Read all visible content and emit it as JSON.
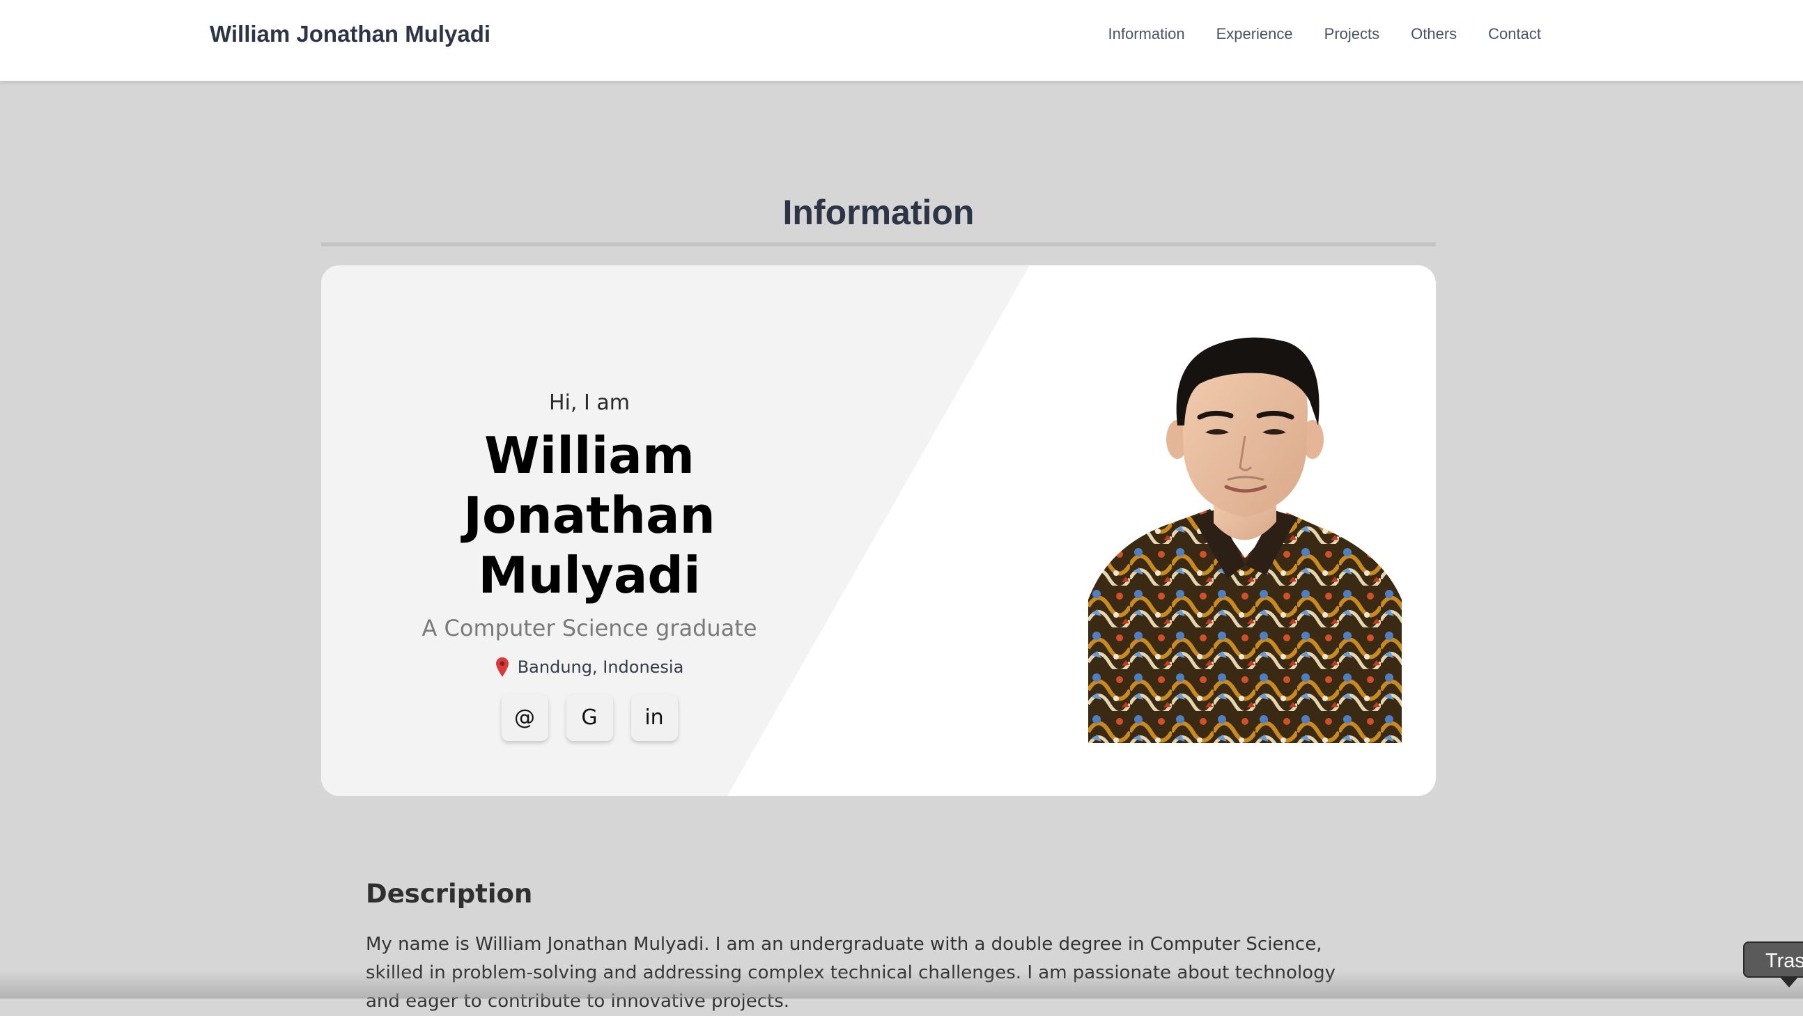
{
  "header": {
    "brand": "William Jonathan Mulyadi",
    "nav": [
      {
        "label": "Information"
      },
      {
        "label": "Experience"
      },
      {
        "label": "Projects"
      },
      {
        "label": "Others"
      },
      {
        "label": "Contact"
      }
    ]
  },
  "section": {
    "title": "Information"
  },
  "hero": {
    "greeting": "Hi, I am",
    "name": "William Jonathan Mulyadi",
    "tagline": "A Computer Science graduate",
    "location": "Bandung, Indonesia",
    "location_icon": "map-pin-icon",
    "pin_color": "#d93b3b",
    "socials": [
      {
        "label": "@",
        "icon": "email-icon"
      },
      {
        "label": "G",
        "icon": "github-icon"
      },
      {
        "label": "in",
        "icon": "linkedin-icon"
      }
    ]
  },
  "description": {
    "title": "Description",
    "body": "My name is William Jonathan Mulyadi. I am an undergraduate with a double degree in Computer Science, skilled in problem-solving and addressing complex technical challenges. I am passionate about technology and eager to contribute to innovative projects."
  },
  "floating_tab": {
    "label": "Tras"
  },
  "colors": {
    "page_background": "#d6d6d6",
    "heading": "#2c3446",
    "card": "#ffffff",
    "card_shade": "#f3f3f3"
  }
}
